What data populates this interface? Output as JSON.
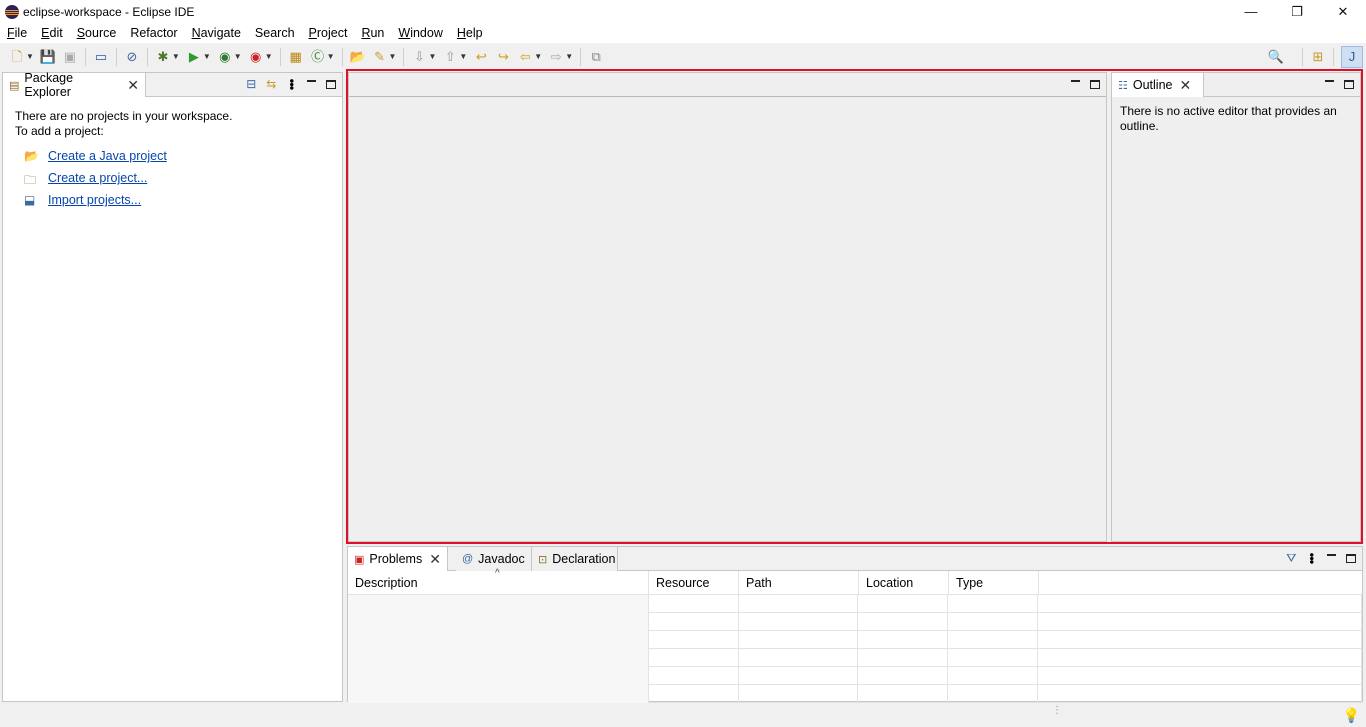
{
  "window": {
    "title": "eclipse-workspace - Eclipse IDE",
    "minimize": "—",
    "restore": "❐",
    "close": "✕"
  },
  "menu": {
    "items": [
      {
        "label": "File",
        "underline": "F",
        "rest": "ile"
      },
      {
        "label": "Edit",
        "underline": "E",
        "rest": "dit"
      },
      {
        "label": "Source",
        "underline": "S",
        "rest": "ource"
      },
      {
        "label": "Refactor",
        "underline": "",
        "rest": "Refactor"
      },
      {
        "label": "Navigate",
        "underline": "N",
        "rest": "avigate"
      },
      {
        "label": "Search",
        "underline": "",
        "rest": "Search"
      },
      {
        "label": "Project",
        "underline": "P",
        "rest": "roject"
      },
      {
        "label": "Run",
        "underline": "R",
        "rest": "un"
      },
      {
        "label": "Window",
        "underline": "W",
        "rest": "indow"
      },
      {
        "label": "Help",
        "underline": "H",
        "rest": "elp"
      }
    ]
  },
  "package_explorer": {
    "tab_label": "Package Explorer",
    "message_line1": "There are no projects in your workspace.",
    "message_line2": "To add a project:",
    "links": [
      {
        "label": "Create a Java project",
        "icon": "new-java-project-icon"
      },
      {
        "label": "Create a project...",
        "icon": "new-project-icon"
      },
      {
        "label": "Import projects...",
        "icon": "import-icon"
      }
    ]
  },
  "outline": {
    "tab_label": "Outline",
    "message": "There is no active editor that provides an outline."
  },
  "bottom_panel": {
    "tabs": [
      {
        "label": "Problems",
        "icon": "problems-icon",
        "closable": true
      },
      {
        "label": "Javadoc",
        "icon": "javadoc-icon",
        "closable": false
      },
      {
        "label": "Declaration",
        "icon": "declaration-icon",
        "closable": false
      }
    ],
    "columns": [
      "Description",
      "Resource",
      "Path",
      "Location",
      "Type"
    ],
    "sorted_column": "Description"
  },
  "colors": {
    "highlight_frame": "#e0102a",
    "link": "#0645ad"
  }
}
